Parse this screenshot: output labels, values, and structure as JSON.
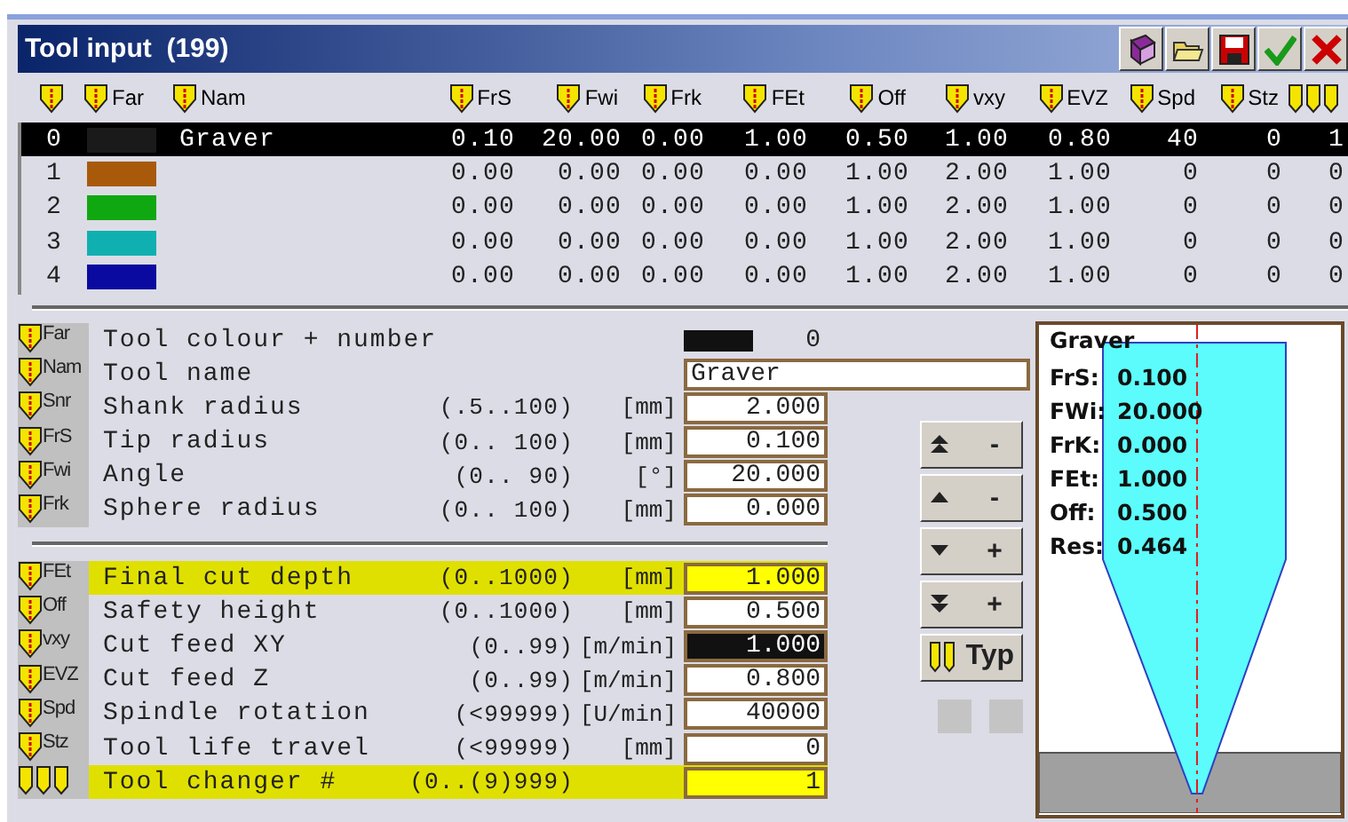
{
  "window": {
    "title": "Tool input  (199)"
  },
  "toolbar": [
    {
      "kind": "help"
    },
    {
      "kind": "open"
    },
    {
      "kind": "save"
    },
    {
      "kind": "confirm"
    },
    {
      "kind": "cancel"
    }
  ],
  "table": {
    "columns": [
      {
        "kind": "number"
      },
      {
        "kind": "color",
        "label": "Far"
      },
      {
        "kind": "name",
        "label": "Nam"
      },
      {
        "kind": "value",
        "label": "FrS"
      },
      {
        "kind": "value",
        "label": "Fwi"
      },
      {
        "kind": "value",
        "label": "Frk"
      },
      {
        "kind": "value",
        "label": "FEt"
      },
      {
        "kind": "value",
        "label": "Off"
      },
      {
        "kind": "value",
        "label": "vxy"
      },
      {
        "kind": "value",
        "label": "EVZ"
      },
      {
        "kind": "value",
        "label": "Spd"
      },
      {
        "kind": "value",
        "label": "Stz"
      },
      {
        "kind": "value"
      }
    ],
    "rows": [
      {
        "number": "0",
        "color": "#1a1a1a",
        "name": "Graver",
        "values": [
          "0.10",
          "20.00",
          "0.00",
          "1.00",
          "0.50",
          "1.00",
          "0.80",
          "40",
          "0",
          "1"
        ],
        "selected": true
      },
      {
        "number": "1",
        "color": "#a85a0a",
        "values": [
          "0.00",
          "0.00",
          "0.00",
          "0.00",
          "1.00",
          "2.00",
          "1.00",
          "0",
          "0",
          "0"
        ],
        "selected": false
      },
      {
        "number": "2",
        "color": "#10a810",
        "values": [
          "0.00",
          "0.00",
          "0.00",
          "0.00",
          "1.00",
          "2.00",
          "1.00",
          "0",
          "0",
          "0"
        ],
        "selected": false
      },
      {
        "number": "3",
        "color": "#10b0b0",
        "values": [
          "0.00",
          "0.00",
          "0.00",
          "0.00",
          "1.00",
          "2.00",
          "1.00",
          "0",
          "0",
          "0"
        ],
        "selected": false
      },
      {
        "number": "4",
        "color": "#0a0aa0",
        "values": [
          "0.00",
          "0.00",
          "0.00",
          "0.00",
          "1.00",
          "2.00",
          "1.00",
          "0",
          "0",
          "0"
        ],
        "selected": false
      }
    ]
  },
  "form": {
    "groups": [
      {
        "rows": [
          {
            "icon_label": "Far",
            "label": "Tool colour + number",
            "kind": "swatch",
            "color": "#111111",
            "value": "0",
            "highlighted": false,
            "focused": false
          },
          {
            "icon_label": "Nam",
            "label": "Tool name",
            "kind": "text",
            "value": "Graver",
            "highlighted": false,
            "focused": false
          },
          {
            "icon_label": "Snr",
            "label": "Shank radius",
            "range": "(.5..100)",
            "unit": "[mm]",
            "kind": "number",
            "value": "2.000",
            "highlighted": false,
            "focused": false
          },
          {
            "icon_label": "FrS",
            "label": "Tip radius",
            "range": "(0.. 100)",
            "unit": "[mm]",
            "kind": "number",
            "value": "0.100",
            "highlighted": false,
            "focused": false
          },
          {
            "icon_label": "Fwi",
            "label": "Angle",
            "range": "(0.. 90)",
            "unit": "[°]",
            "kind": "number",
            "value": "20.000",
            "highlighted": false,
            "focused": false
          },
          {
            "icon_label": "Frk",
            "label": "Sphere radius",
            "range": "(0.. 100)",
            "unit": "[mm]",
            "kind": "number",
            "value": "0.000",
            "highlighted": false,
            "focused": false
          }
        ]
      },
      {
        "rows": [
          {
            "icon_label": "FEt",
            "label": "Final cut depth",
            "range": "(0..1000)",
            "unit": "[mm]",
            "kind": "number",
            "value": "1.000",
            "highlighted": true,
            "focused": false
          },
          {
            "icon_label": "Off",
            "label": "Safety height",
            "range": "(0..1000)",
            "unit": "[mm]",
            "kind": "number",
            "value": "0.500",
            "highlighted": false,
            "focused": false
          },
          {
            "icon_label": "vxy",
            "label": "Cut feed XY",
            "range": "(0..99)",
            "unit": "[m/min]",
            "kind": "number",
            "value": "1.000",
            "highlighted": false,
            "focused": true
          },
          {
            "icon_label": "EVZ",
            "label": "Cut feed Z",
            "range": "(0..99)",
            "unit": "[m/min]",
            "kind": "number",
            "value": "0.800",
            "highlighted": false,
            "focused": false
          },
          {
            "icon_label": "Spd",
            "label": "Spindle rotation",
            "range": "(<99999)",
            "unit": "[U/min]",
            "kind": "number",
            "value": "40000",
            "highlighted": false,
            "focused": false
          },
          {
            "icon_label": "Stz",
            "label": "Tool life travel",
            "range": "(<99999)",
            "unit": "[mm]",
            "kind": "number",
            "value": "0",
            "highlighted": false,
            "focused": false
          },
          {
            "label": "Tool changer #",
            "range": "(0..(9)999)",
            "kind": "number",
            "value": "1",
            "highlighted": true,
            "focused": false
          }
        ]
      }
    ]
  },
  "nav_buttons": [
    {
      "kind": "up-fast",
      "label": "-"
    },
    {
      "kind": "up",
      "label": "-"
    },
    {
      "kind": "down",
      "label": "+"
    },
    {
      "kind": "down-fast",
      "label": "+"
    },
    {
      "kind": "type",
      "label": "Typ"
    }
  ],
  "small_buttons": [
    {
      "disabled": true
    },
    {
      "disabled": true
    }
  ],
  "preview": {
    "title": "Graver",
    "readouts": [
      {
        "label": "FrS:",
        "value": "0.100"
      },
      {
        "label": "FWi:",
        "value": "20.000"
      },
      {
        "label": "FrK:",
        "value": "0.000"
      },
      {
        "label": "FEt:",
        "value": "1.000"
      },
      {
        "label": "Off:",
        "value": "0.500"
      },
      {
        "label": "Res:",
        "value": "0.464"
      }
    ]
  }
}
